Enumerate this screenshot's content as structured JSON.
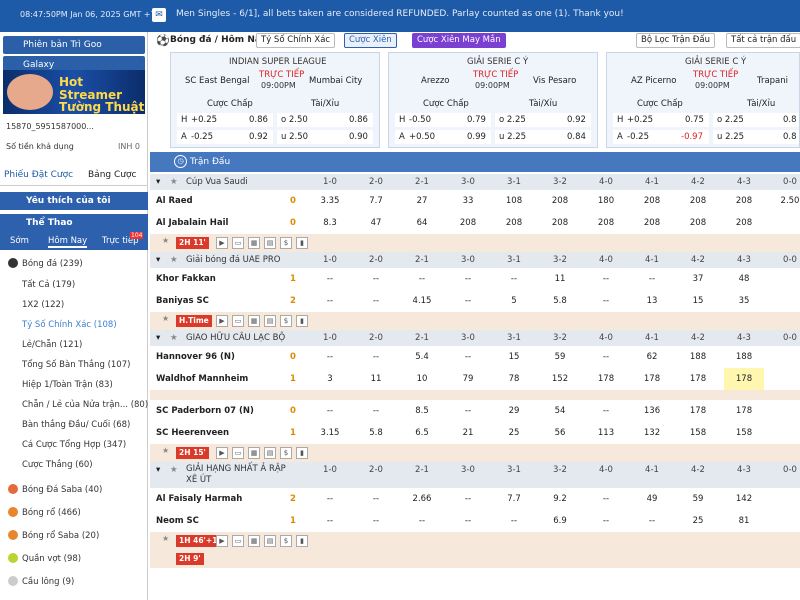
{
  "topbar": {
    "time": "08:47:50PM Jan 06, 2025 GMT +7",
    "announcement": "Men Singles - 6/1], all bets taken are considered REFUNDED. Parlay counted as one (1). Thank you!"
  },
  "sidebar": {
    "btn_version": "Phiên bản Trì Goo",
    "btn_galaxy": "Galaxy",
    "banner": "Hot Streamer Tường Thuật",
    "account": "15870_5951587000...",
    "balance_label": "Số tiền khả dụng",
    "balance_value": "INH 0",
    "tab_bet": "Phiếu Đặt Cược",
    "tab_table": "Bảng Cược",
    "fav": "Yêu thích của tôi",
    "sports": "Thể Thao",
    "sub_early": "Sớm",
    "sub_today": "Hôm Nay",
    "sub_live": "Trực tiếp",
    "sub_live_count": "104",
    "football": "Bóng đá (239)",
    "items": [
      "Tất Cả (179)",
      "1X2 (122)",
      "Tỷ Số Chính Xác (108)",
      "Lẻ/Chẵn (121)",
      "Tổng Số Bàn Thắng (107)",
      "Hiệp 1/Toàn Trận (83)",
      "Chẵn / Lẻ của Nửa trận... (80)",
      "Bàn thắng Đầu/ Cuối (68)",
      "Cá Cược Tổng Hợp (347)",
      "Cược Thắng (60)"
    ],
    "other_sports": [
      "Bóng Đá Saba (40)",
      "Bóng rổ (466)",
      "Bóng rổ Saba (20)",
      "Quần vợt (98)",
      "Cầu lông (9)"
    ]
  },
  "filters": {
    "breadcrumb": "Bóng đá / Hôm Nay",
    "market": "Tỷ Số Chính Xác",
    "parlay": "Cược Xiên",
    "parlay_lucky": "Cược Xiên May Mắn",
    "match_filter": "Bộ Lọc Trận Đấu",
    "all_matches": "Tất cả trận đấu"
  },
  "cards": [
    {
      "league": "INDIAN SUPER LEAGUE",
      "home": "SC East Bengal",
      "away": "Mumbai City",
      "live": "TRỰC TIẾP",
      "time": "09:00PM",
      "hcap": "Cược Chấp",
      "ou": "Tài/Xỉu",
      "r1": [
        "H",
        "+0.25",
        "0.86",
        "o 2.50",
        "0.86"
      ],
      "r2": [
        "A",
        "-0.25",
        "0.92",
        "u 2.50",
        "0.90"
      ]
    },
    {
      "league": "GIẢI SERIE C Ý",
      "home": "Arezzo",
      "away": "Vis Pesaro",
      "live": "TRỰC TIẾP",
      "time": "09:00PM",
      "hcap": "Cược Chấp",
      "ou": "Tài/Xỉu",
      "r1": [
        "H",
        "-0.50",
        "0.79",
        "o 2.25",
        "0.92"
      ],
      "r2": [
        "A",
        "+0.50",
        "0.99",
        "u 2.25",
        "0.84"
      ]
    },
    {
      "league": "GIẢI SERIE C Ý",
      "home": "AZ Picerno",
      "away": "Trapani",
      "live": "TRỰC TIẾP",
      "time": "09:00PM",
      "hcap": "Cược Chấp",
      "ou": "Tài/Xỉu",
      "r1": [
        "H",
        "+0.25",
        "0.75",
        "o 2.25",
        "0.8"
      ],
      "r2": [
        "A",
        "-0.25",
        "-0.97",
        "u 2.25",
        "0.8"
      ]
    }
  ],
  "table": {
    "header": "Trận Đấu",
    "scores": [
      "1-0",
      "2-0",
      "2-1",
      "3-0",
      "3-1",
      "3-2",
      "4-0",
      "4-1",
      "4-2",
      "4-3",
      "0-0"
    ],
    "leagues": [
      {
        "name": "Cúp Vua Saudi",
        "badge": "2H 11'",
        "matches": [
          {
            "team": "Al Raed",
            "goals": "0",
            "odds": [
              "3.35",
              "7.7",
              "27",
              "33",
              "108",
              "208",
              "180",
              "208",
              "208",
              "208",
              "2.50"
            ]
          },
          {
            "team": "Al Jabalain Hail",
            "goals": "0",
            "odds": [
              "8.3",
              "47",
              "64",
              "208",
              "208",
              "208",
              "208",
              "208",
              "208",
              "208",
              ""
            ]
          }
        ]
      },
      {
        "name": "Giải bóng đá UAE PRO",
        "badge": "H.Time",
        "matches": [
          {
            "team": "Khor Fakkan",
            "goals": "1",
            "odds": [
              "--",
              "--",
              "--",
              "--",
              "--",
              "11",
              "--",
              "--",
              "37",
              "48",
              ""
            ]
          },
          {
            "team": "Baniyas SC",
            "goals": "2",
            "odds": [
              "--",
              "--",
              "4.15",
              "--",
              "5",
              "5.8",
              "--",
              "13",
              "15",
              "35",
              ""
            ]
          }
        ]
      },
      {
        "name": "GIAO HỮU CÂU LẠC BỘ",
        "badge": "2H 15'",
        "matches": [
          {
            "team": "Hannover 96 (N)",
            "goals": "0",
            "odds": [
              "--",
              "--",
              "5.4",
              "--",
              "15",
              "59",
              "--",
              "62",
              "188",
              "188",
              ""
            ]
          },
          {
            "team": "Waldhof Mannheim",
            "goals": "1",
            "odds": [
              "3",
              "11",
              "10",
              "79",
              "78",
              "152",
              "178",
              "178",
              "178",
              "178",
              ""
            ]
          },
          {
            "team": "SC Paderborn 07 (N)",
            "goals": "0",
            "odds": [
              "--",
              "--",
              "8.5",
              "--",
              "29",
              "54",
              "--",
              "136",
              "178",
              "178",
              ""
            ]
          },
          {
            "team": "SC Heerenveen",
            "goals": "1",
            "odds": [
              "3.15",
              "5.8",
              "6.5",
              "21",
              "25",
              "56",
              "113",
              "132",
              "158",
              "158",
              ""
            ]
          }
        ]
      },
      {
        "name": "GIẢI HẠNG NHẤT Ả RẬP XÊ ÚT",
        "badge": "1H 46'+1",
        "matches": [
          {
            "team": "Al Faisaly Harmah",
            "goals": "2",
            "odds": [
              "--",
              "--",
              "2.66",
              "--",
              "7.7",
              "9.2",
              "--",
              "49",
              "59",
              "142",
              ""
            ]
          },
          {
            "team": "Neom SC",
            "goals": "1",
            "odds": [
              "--",
              "--",
              "--",
              "--",
              "--",
              "6.9",
              "--",
              "--",
              "25",
              "81",
              ""
            ]
          }
        ]
      }
    ],
    "badge_extra": "2H 9'"
  },
  "colors": {
    "primary": "#1d5ba8",
    "live": "#d22222",
    "goal": "#e08a00"
  }
}
